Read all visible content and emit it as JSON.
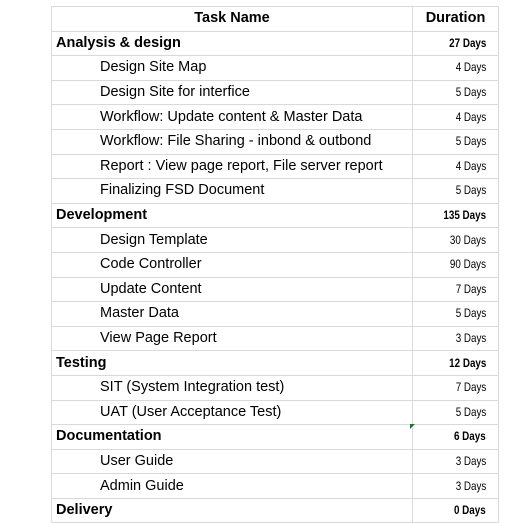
{
  "header": {
    "task": "Task Name",
    "duration": "Duration"
  },
  "rows": [
    {
      "name": "Analysis & design",
      "duration": "27 Days",
      "level": "group"
    },
    {
      "name": "Design Site Map",
      "duration": "4 Days",
      "level": "sub"
    },
    {
      "name": "Design Site for interfice",
      "duration": "5 Days",
      "level": "sub"
    },
    {
      "name": "Workflow: Update content & Master Data",
      "duration": "4 Days",
      "level": "sub"
    },
    {
      "name": "Workflow: File Sharing - inbond & outbond",
      "duration": "5 Days",
      "level": "sub"
    },
    {
      "name": "Report : View page report, File server report",
      "duration": "4 Days",
      "level": "sub"
    },
    {
      "name": "Finalizing FSD Document",
      "duration": "5 Days",
      "level": "sub"
    },
    {
      "name": "Development",
      "duration": "135 Days",
      "level": "group"
    },
    {
      "name": "Design Template",
      "duration": "30 Days",
      "level": "sub"
    },
    {
      "name": "Code Controller",
      "duration": "90 Days",
      "level": "sub"
    },
    {
      "name": "Update Content",
      "duration": "7 Days",
      "level": "sub"
    },
    {
      "name": "Master Data",
      "duration": "5 Days",
      "level": "sub"
    },
    {
      "name": "View Page Report",
      "duration": "3 Days",
      "level": "sub"
    },
    {
      "name": "Testing",
      "duration": "12 Days",
      "level": "group"
    },
    {
      "name": "SIT (System Integration test)",
      "duration": "7 Days",
      "level": "sub"
    },
    {
      "name": "UAT (User Acceptance Test)",
      "duration": "5 Days",
      "level": "sub"
    },
    {
      "name": "Documentation",
      "duration": "6 Days",
      "level": "group"
    },
    {
      "name": "User Guide",
      "duration": "3 Days",
      "level": "sub"
    },
    {
      "name": "Admin Guide",
      "duration": "3 Days",
      "level": "sub"
    },
    {
      "name": "Delivery",
      "duration": "0 Days",
      "level": "group"
    }
  ],
  "colors": {
    "grid": "#d9d9d9",
    "marker": "#1a7a34"
  }
}
